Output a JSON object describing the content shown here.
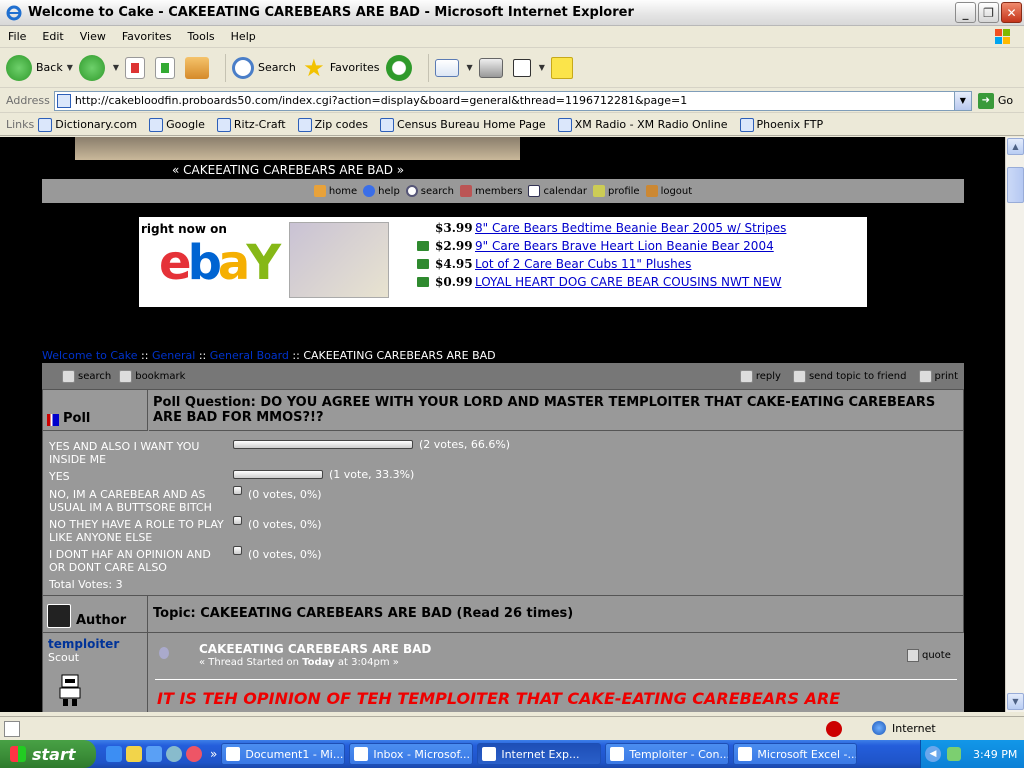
{
  "window": {
    "title": "Welcome to Cake - CAKEEATING CAREBEARS ARE BAD - Microsoft Internet Explorer"
  },
  "menu": [
    "File",
    "Edit",
    "View",
    "Favorites",
    "Tools",
    "Help"
  ],
  "toolbar": {
    "back": "Back",
    "search": "Search",
    "favorites": "Favorites"
  },
  "address": {
    "label": "Address",
    "url": "http://cakebloodfin.proboards50.com/index.cgi?action=display&board=general&thread=1196712281&page=1",
    "go": "Go"
  },
  "links": {
    "label": "Links",
    "items": [
      "Dictionary.com",
      "Google",
      "Ritz-Craft",
      "Zip codes",
      "Census Bureau Home Page",
      "XM Radio - XM Radio Online",
      "Phoenix FTP"
    ]
  },
  "forum": {
    "banner_title": "« CAKEEATING CAREBEARS ARE BAD »",
    "nav": [
      "home",
      "help",
      "search",
      "members",
      "calendar",
      "profile",
      "logout"
    ],
    "ebay": {
      "right_now": "right now on",
      "logo_letters": [
        "e",
        "b",
        "a",
        "Y"
      ],
      "items": [
        {
          "price": "$3.99",
          "title": "8\" Care Bears Bedtime Beanie Bear 2005 w/ Stripes"
        },
        {
          "price": "$2.99",
          "title": "9\" Care Bears Brave Heart Lion Beanie Bear 2004"
        },
        {
          "price": "$4.95",
          "title": "Lot of 2 Care Bear Cubs 11\" Plushes"
        },
        {
          "price": "$0.99",
          "title": "LOYAL HEART DOG CARE BEAR COUSINS NWT NEW"
        }
      ]
    },
    "breadcrumb": {
      "home": "Welcome to Cake",
      "cat": "General",
      "board": "General Board",
      "thread": "CAKEEATING CAREBEARS ARE BAD",
      "sep": "::"
    },
    "thread_tools": {
      "search": "search",
      "bookmark": "bookmark",
      "reply": "reply",
      "send": "send topic to friend",
      "print": "print"
    },
    "poll": {
      "label": "Poll",
      "question": "Poll Question: DO YOU AGREE WITH YOUR LORD AND MASTER TEMPLOITER THAT CAKE-EATING CAREBEARS ARE BAD FOR MMOS?!?",
      "options": [
        {
          "text": "YES AND ALSO I WANT YOU INSIDE ME",
          "count": "(2 votes, 66.6%)",
          "pct": 66.6
        },
        {
          "text": "YES",
          "count": "(1 vote, 33.3%)",
          "pct": 33.3
        },
        {
          "text": "NO, IM A CAREBEAR AND AS USUAL IM A BUTTSORE BITCH",
          "count": "(0 votes, 0%)",
          "pct": 0
        },
        {
          "text": "NO THEY HAVE A ROLE TO PLAY LIKE ANYONE ELSE",
          "count": "(0 votes, 0%)",
          "pct": 0
        },
        {
          "text": "I DONT HAF AN OPINION AND OR DONT CARE ALSO",
          "count": "(0 votes, 0%)",
          "pct": 0
        }
      ],
      "total": "Total Votes: 3"
    },
    "topic": {
      "author_label": "Author",
      "title": "Topic: CAKEEATING CAREBEARS ARE BAD (Read 26 times)"
    },
    "post": {
      "username": "temploiter",
      "rank": "Scout",
      "title": "CAKEEATING CAREBEARS ARE BAD",
      "meta_prefix": "« Thread Started on ",
      "meta_day": "Today",
      "meta_suffix": " at 3:04pm »",
      "quote": "quote",
      "body": "IT IS TEH OPINION OF TEH TEMPLOITER THAT CAKE-EATING CAREBEARS ARE"
    }
  },
  "status": {
    "zone": "Internet"
  },
  "taskbar": {
    "start": "start",
    "more": "»",
    "tasks": [
      "Document1 - Mi...",
      "Inbox - Microsof...",
      "Internet Exp...",
      "Temploiter - Con...",
      "Microsoft Excel -..."
    ],
    "clock": "3:49 PM"
  },
  "colors": {
    "link": "#0033cc",
    "post_body": "#ee0000",
    "forum_bg": "#999999"
  }
}
